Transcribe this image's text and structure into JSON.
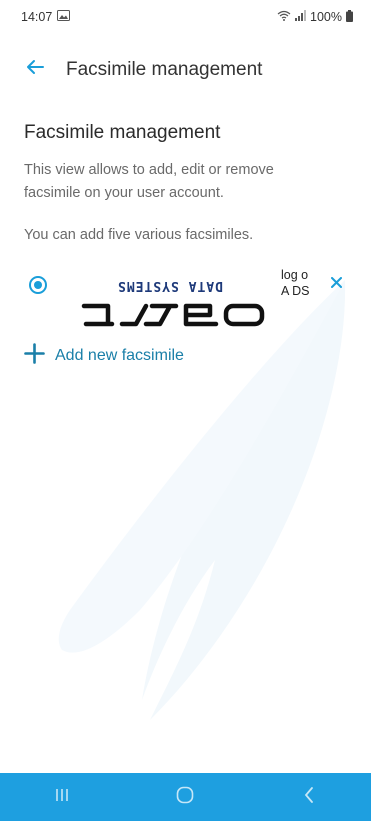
{
  "status_bar": {
    "time": "14:07",
    "battery": "100%",
    "icons": [
      "gallery-icon",
      "wifi-icon",
      "signal-icon",
      "battery-icon"
    ]
  },
  "app_bar": {
    "back_icon": "back-arrow-icon",
    "title": "Facsimile management"
  },
  "content": {
    "heading": "Facsimile management",
    "description": "This view allows to add, edit or remove facsimile on your user account.",
    "info": "You can add five various facsimiles."
  },
  "facsimiles": [
    {
      "selected": true,
      "logo_text_top": "DATA SYSTEMS",
      "logo_wordmark": "asseco",
      "caption": "log o A DS",
      "remove_icon": "close-icon"
    }
  ],
  "add_button": {
    "label": "Add new facsimile",
    "icon": "plus-icon"
  },
  "nav_bar": {
    "buttons": [
      "recent-apps-icon",
      "home-icon",
      "back-icon"
    ]
  },
  "colors": {
    "accent": "#1a9ed9",
    "add_text": "#1a7fa8",
    "nav_bar": "#1e9fe0",
    "watermark": "#f2f8fc"
  }
}
